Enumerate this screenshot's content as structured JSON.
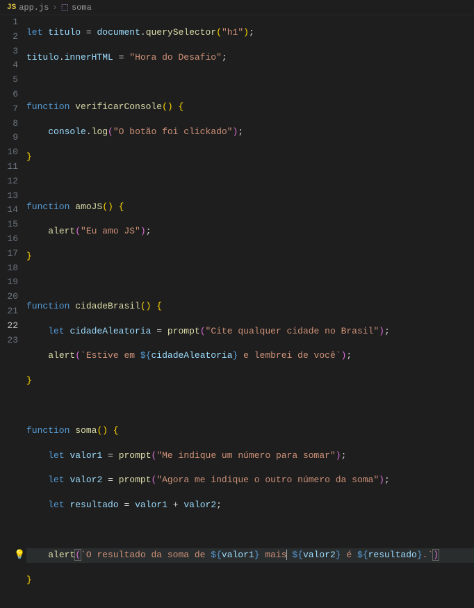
{
  "breadcrumb": {
    "file_icon_label": "JS",
    "file_name": "app.js",
    "symbol_name": "soma"
  },
  "editor": {
    "line_numbers": [
      "1",
      "2",
      "3",
      "4",
      "5",
      "6",
      "7",
      "8",
      "9",
      "10",
      "11",
      "12",
      "13",
      "14",
      "15",
      "16",
      "17",
      "18",
      "19",
      "20",
      "21",
      "22",
      "23"
    ],
    "active_line": 22,
    "lightbulb_line": 22
  },
  "chart_data": {
    "type": "table",
    "language": "javascript",
    "code_lines": [
      "let titulo = document.querySelector(\"h1\");",
      "titulo.innerHTML = \"Hora do Desafio\";",
      "",
      "function verificarConsole() {",
      "    console.log(\"O botão foi clickado\");",
      "}",
      "",
      "function amoJS() {",
      "    alert(\"Eu amo JS\");",
      "}",
      "",
      "function cidadeBrasil() {",
      "    let cidadeAleatoria = prompt(\"Cite qualquer cidade no Brasil\");",
      "    alert(`Estive em ${cidadeAleatoria} e lembrei de você`);",
      "}",
      "",
      "function soma() {",
      "    let valor1 = prompt(\"Me indique um número para somar\");",
      "    let valor2 = prompt(\"Agora me indique o outro número da soma\");",
      "    let resultado = valor1 + valor2;",
      "",
      "    alert(`O resultado da soma de ${valor1} mais ${valor2} é ${resultado}.`)",
      "}"
    ]
  },
  "tokens": {
    "let": "let",
    "function": "function",
    "titulo": "titulo",
    "document": "document",
    "querySelector": "querySelector",
    "h1": "\"h1\"",
    "innerHTML": "innerHTML",
    "hora": "\"Hora do Desafio\"",
    "verificarConsole": "verificarConsole",
    "console": "console",
    "log": "log",
    "botao": "\"O botão foi clickado\"",
    "amoJS": "amoJS",
    "alert": "alert",
    "euamo": "\"Eu amo JS\"",
    "cidadeBrasil": "cidadeBrasil",
    "cidadeAleatoria": "cidadeAleatoria",
    "prompt": "prompt",
    "cite": "\"Cite qualquer cidade no Brasil\"",
    "estive1": "`Estive em ",
    "estive2": " e lembrei de você`",
    "soma": "soma",
    "valor1": "valor1",
    "valor2": "valor2",
    "resultado": "resultado",
    "meindique": "\"Me indique um número para somar\"",
    "agora": "\"Agora me indique o outro número da soma\"",
    "tmpl_a": "`O resultado da soma de ",
    "tmpl_b": " mais",
    "tmpl_c": " é ",
    "tmpl_d": ".`",
    "dollar_open": "${",
    "close_brace": "}"
  }
}
